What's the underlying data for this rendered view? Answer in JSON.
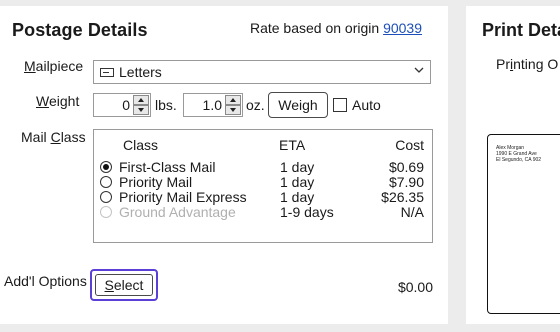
{
  "postage": {
    "title": "Postage Details",
    "rate_prefix": "Rate based on origin ",
    "origin_zip": "90039",
    "mailpiece": {
      "label_pre": "",
      "label_u": "M",
      "label_post": "ailpiece",
      "value": "Letters"
    },
    "weight": {
      "label_u": "W",
      "label_post": "eight",
      "lbs_value": "0",
      "lbs_unit": "lbs.",
      "oz_value": "1.0",
      "oz_unit": "oz.",
      "weigh_label": "Weigh",
      "auto_label": "Auto"
    },
    "mail_class": {
      "label_pre": "Mail ",
      "label_u": "C",
      "label_post": "lass",
      "headers": {
        "class": "Class",
        "eta": "ETA",
        "cost": "Cost"
      },
      "rows": [
        {
          "name": "First-Class Mail",
          "eta": "1 day",
          "cost": "$0.69"
        },
        {
          "name": "Priority Mail",
          "eta": "1 day",
          "cost": "$7.90"
        },
        {
          "name": "Priority Mail Express",
          "eta": "1 day",
          "cost": "$26.35"
        },
        {
          "name": "Ground Advantage",
          "eta": "1-9 days",
          "cost": "N/A"
        }
      ]
    },
    "addl": {
      "label": "Add'l Options",
      "button_u": "S",
      "button_post": "elect",
      "amount": "$0.00"
    }
  },
  "print": {
    "title": "Print Deta",
    "sub_pre": "Pr",
    "sub_u": "i",
    "sub_post": "nting O",
    "address": [
      "Alex Morgan",
      "1990 E Grand Ave",
      "El Segundo, CA 902"
    ]
  },
  "colors": {
    "link": "#1d4fb8",
    "focus_border": "#5b3fd6",
    "panel_bg": "#ffffff",
    "page_bg": "#ececec"
  }
}
